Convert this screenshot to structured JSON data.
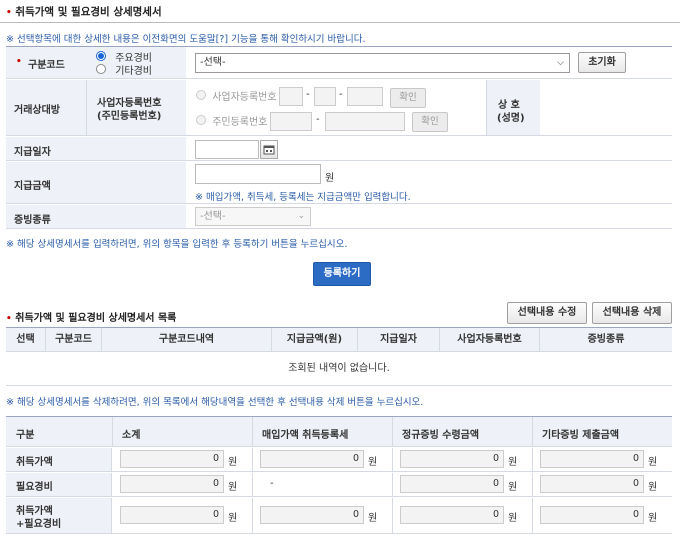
{
  "header": {
    "title": "취득가액 및 필요경비 상세명세서"
  },
  "notes": {
    "top": "※ 선택항목에 대한 상세한 내용은 이전화면의 도움말[?] 기능을 통해 확인하시기 바랍니다.",
    "register": "※ 해당 상세명세서를 입력하려면, 위의 항목을 입력한 후 등록하기 버튼을 누르십시오.",
    "delete": "※ 해당 상세명세서를 삭제하려면, 위의 목록에서 해당내역을 선택한 후 선택내용 삭제 버튼을 누르십시오."
  },
  "form": {
    "category_label": "구분코드",
    "radio_main": "주요경비",
    "radio_other": "기타경비",
    "select_value": "-선택-",
    "reset_button": "초기화",
    "partner_label": "거래상대방",
    "bizno_label": "사업자등록번호",
    "idno_label": "(주민등록번호)",
    "radio_bizno": "사업자등록번호",
    "radio_idno": "주민등록번호",
    "dash": "-",
    "confirm": "확인",
    "trade_name": "상 호",
    "trade_name2": "(성명)",
    "pay_date_label": "지급일자",
    "pay_amount_label": "지급금액",
    "won": "원",
    "amount_note": "※ 매입가액, 취득세, 등록세는 지급금액만 입력합니다.",
    "proof_label": "증빙종류",
    "proof_value": "-선택-",
    "register_button": "등록하기"
  },
  "list": {
    "title": "취득가액 및 필요경비 상세명세서 목록",
    "edit_button": "선택내용 수정",
    "delete_button": "선택내용 삭제",
    "columns": [
      "선택",
      "구분코드",
      "구분코드내역",
      "지급금액(원)",
      "지급일자",
      "사업자등록번호",
      "증빙종류"
    ],
    "empty": "조회된 내역이 없습니다."
  },
  "summary": {
    "columns": [
      "구분",
      "소계",
      "매입가액 취득등록세",
      "정규증빙 수령금액",
      "기타증빙 제출금액"
    ],
    "rows": [
      {
        "label": "취득가액",
        "values": [
          "0",
          "0",
          "0",
          "0"
        ]
      },
      {
        "label": "필요경비",
        "values": [
          "0",
          "-",
          "0",
          "0"
        ]
      },
      {
        "label": "취득가액",
        "label2": "+필요경비",
        "values": [
          "0",
          "0",
          "0",
          "0"
        ]
      }
    ],
    "won": "원"
  },
  "colors": {
    "accent": "#2a5ba8",
    "required_dot": "#cc0000",
    "header_bg": "#eef1f7",
    "register_bg": "#2d6cc5"
  }
}
